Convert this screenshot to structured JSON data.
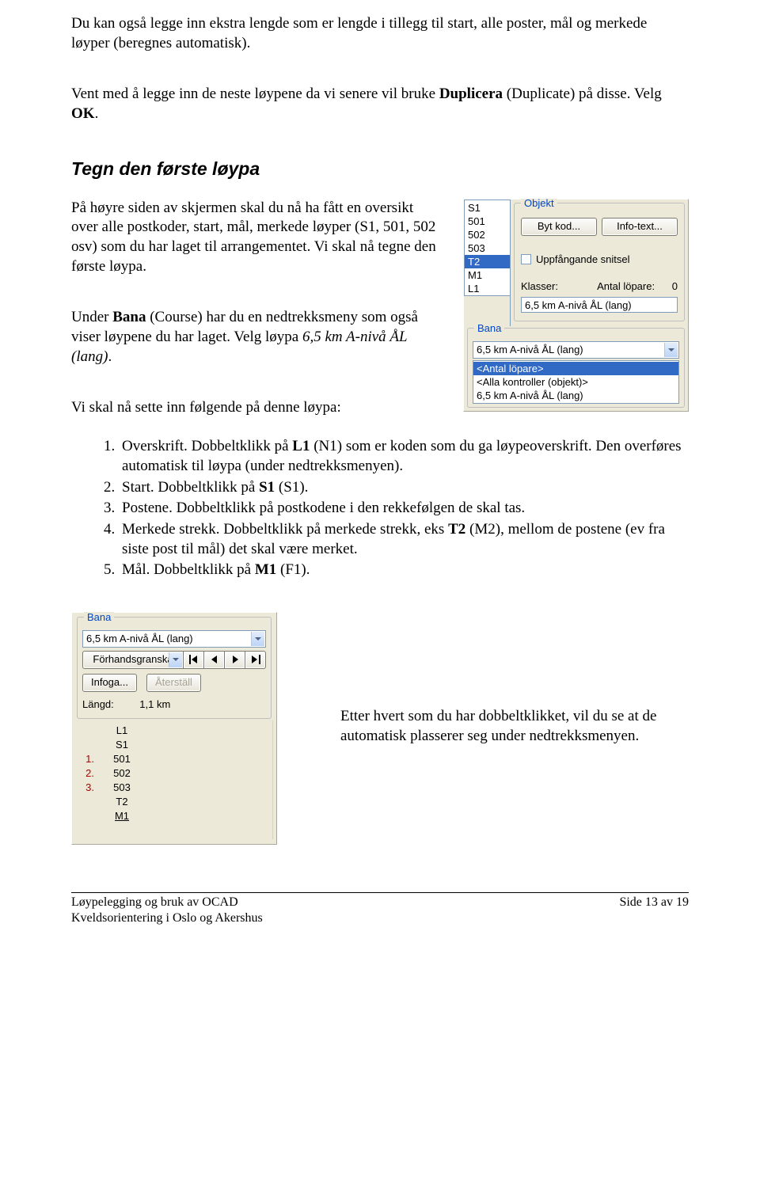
{
  "paragraphs": {
    "intro1a": "Du kan også legge inn ekstra lengde som er lengde i tillegg til start, alle poster, mål og merkede løyper (beregnes automatisk).",
    "intro2a": "Vent med å legge inn de neste løypene da vi senere vil bruke ",
    "intro2b": "Duplicera",
    "intro2c": " (Duplicate) på disse. Velg ",
    "intro2d": "OK",
    "intro2e": "."
  },
  "heading1": "Tegn den første løypa",
  "left": {
    "p1": "På høyre siden av skjermen skal du nå ha fått en oversikt over alle postkoder, start, mål, merkede løyper (S1, 501, 502 osv) som du har laget til arrangementet. Vi skal nå tegne den første løypa.",
    "p2a": "Under ",
    "p2b": "Bana",
    "p2c": " (Course) har du en nedtrekksmeny som også viser løypene du har laget. Velg løypa ",
    "p2d": "6,5 km A-nivå ÅL (lang)",
    "p2e": ".",
    "p3": "Vi skal nå sette inn følgende på denne løypa:",
    "li1a": "Overskrift. Dobbeltklikk på ",
    "li1b": "L1",
    "li1c": " (N1) som er koden som du ga løypeoverskrift. Den overføres automatisk til løypa (under nedtrekksmenyen).",
    "li2a": "Start. Dobbeltklikk på ",
    "li2b": "S1",
    "li2c": " (S1).",
    "li3": "Postene. Dobbeltklikk på postkodene i den rekkefølgen de skal tas.",
    "li4a": "Merkede strekk. Dobbeltklikk på merkede strekk, eks ",
    "li4b": "T2",
    "li4c": " (M2), mellom de postene (ev fra siste post til mål) det skal være merket.",
    "li5a": "Mål. Dobbeltklikk på ",
    "li5b": "M1",
    "li5c": " (F1)."
  },
  "panel1": {
    "list": [
      "S1",
      "501",
      "502",
      "503",
      "T2",
      "M1",
      "L1"
    ],
    "list_selected_index": 4,
    "objekt_legend": "Objekt",
    "btn_bytkod": "Byt kod...",
    "btn_infotext": "Info-text...",
    "chk_label": "Uppfångande snitsel",
    "klasser_label": "Klasser:",
    "antal_label": "Antal löpare:",
    "antal_value": "0",
    "klass_value": "6,5 km A-nivå  ÅL (lang)",
    "bana_legend": "Bana",
    "bana_select": "6,5 km A-nivå ÅL (lang)",
    "bana_drop": [
      "<Antal löpare>",
      "<Alla kontroller (objekt)>",
      "6,5 km A-nivå ÅL (lang)"
    ],
    "bana_drop_selected": 0
  },
  "panel2": {
    "legend": "Bana",
    "select": "6,5 km A-nivå  ÅL (lang)",
    "preview_label": "Förhandsgranska",
    "infoga": "Infoga...",
    "aterstall": "Återställ",
    "langd_label": "Längd:",
    "langd_value": "1,1 km",
    "rows": [
      {
        "num": "",
        "code": "L1"
      },
      {
        "num": "",
        "code": "S1"
      },
      {
        "num": "1.",
        "code": "501"
      },
      {
        "num": "2.",
        "code": "502"
      },
      {
        "num": "3.",
        "code": "503"
      },
      {
        "num": "",
        "code": "T2"
      },
      {
        "num": "",
        "code": "M1",
        "underline": true
      }
    ]
  },
  "bottom_text": "Etter hvert som du har dobbeltklikket, vil du se at de automatisk plasserer seg under nedtrekksmenyen.",
  "footer": {
    "left1": "Løypelegging og bruk av OCAD",
    "left2": "Kveldsorientering i Oslo og Akershus",
    "right": "Side 13 av 19"
  }
}
